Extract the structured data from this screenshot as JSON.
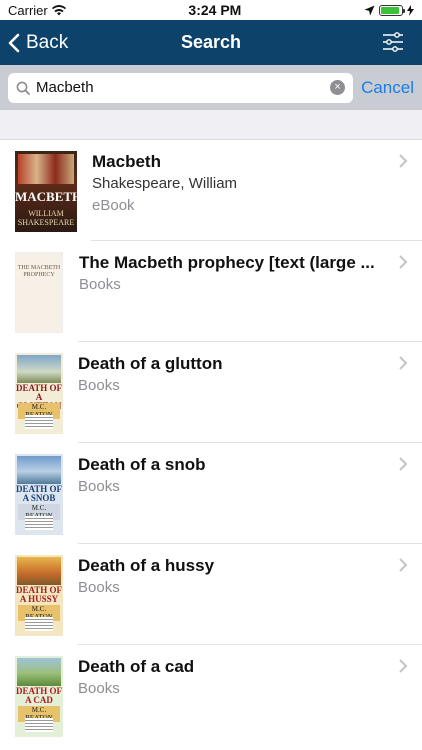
{
  "status_bar": {
    "carrier": "Carrier",
    "time": "3:24 PM",
    "battery_level": 0.9
  },
  "nav": {
    "back_label": "Back",
    "title": "Search"
  },
  "search": {
    "value": "Macbeth",
    "cancel_label": "Cancel"
  },
  "results": [
    {
      "title": "Macbeth",
      "author": "Shakespeare, William",
      "format": "eBook",
      "cover_text": [
        "MACBETH",
        "WILLIAM",
        "SHAKESPEARE"
      ]
    },
    {
      "title": "The Macbeth prophecy [text (large ...",
      "format": "Books",
      "cover_text": [
        "THE MACBETH",
        "PROPHECY"
      ]
    },
    {
      "title": "Death of a glutton",
      "format": "Books",
      "cover_text": [
        "DEATH OF A GLUTTON",
        "M.C. BEATON"
      ]
    },
    {
      "title": "Death of a snob",
      "format": "Books",
      "cover_text": [
        "DEATH OF A SNOB",
        "M.C. BEATON"
      ]
    },
    {
      "title": "Death of a hussy",
      "format": "Books",
      "cover_text": [
        "DEATH OF A HUSSY",
        "M.C. BEATON"
      ]
    },
    {
      "title": "Death of a cad",
      "format": "Books",
      "cover_text": [
        "DEATH OF A CAD",
        "M.C. BEATON"
      ]
    }
  ],
  "colors": {
    "nav_bg": "#0d426a",
    "accent": "#1a7de6",
    "search_bg": "#c9ccd2"
  }
}
